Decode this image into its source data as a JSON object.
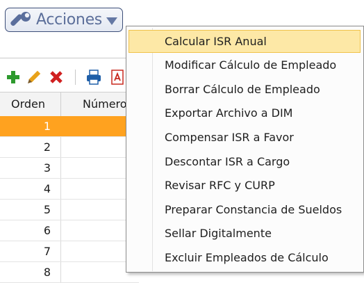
{
  "actions_button": {
    "label": "Acciones",
    "icon": "wrench-icon"
  },
  "toolbar": {
    "icons": [
      "add-icon",
      "edit-icon",
      "delete-icon",
      "print-icon",
      "pdf-icon"
    ],
    "colors": {
      "add": "#2e9a2e",
      "edit": "#e8a21a",
      "delete": "#d02020",
      "print": "#1f5fa8",
      "pdf": "#c8281e"
    }
  },
  "grid": {
    "columns": [
      "Orden",
      "Número"
    ],
    "rows": [
      "1",
      "2",
      "3",
      "4",
      "5",
      "6",
      "7",
      "8"
    ],
    "selected_row_color": "#ffa21f"
  },
  "menu": {
    "items": [
      "Calcular ISR Anual",
      "Modificar Cálculo de Empleado",
      "Borrar Cálculo de Empleado",
      "Exportar Archivo a DIM",
      "Compensar ISR a Favor",
      "Descontar ISR a Cargo",
      "Revisar RFC y CURP",
      "Preparar Constancia de Sueldos",
      "Sellar Digitalmente",
      "Excluir Empleados de Cálculo"
    ],
    "highlighted_index": 0,
    "highlight_color": "#fde8a6"
  }
}
